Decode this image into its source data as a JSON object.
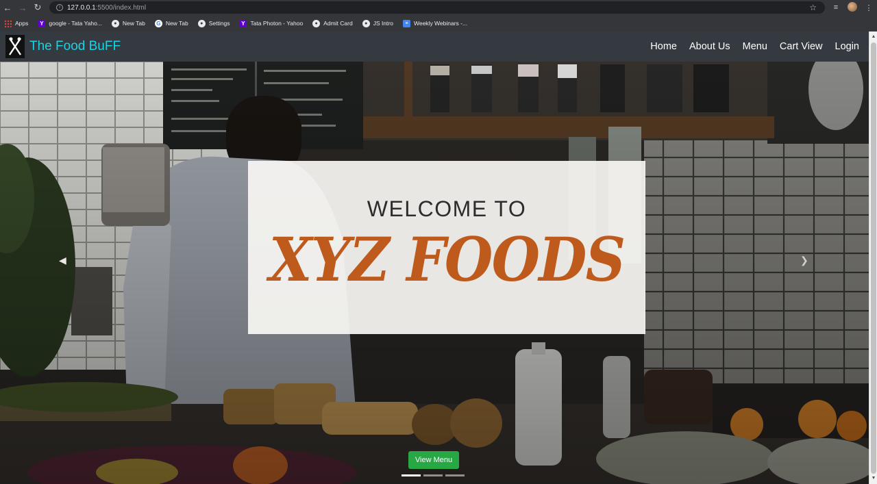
{
  "browser": {
    "url_host": "127.0.0.1",
    "url_rest": ":5500/index.html",
    "bookmarks": [
      {
        "label": "Apps",
        "icon": "apps-grid-icon"
      },
      {
        "label": "google - Tata Yaho...",
        "icon": "yahoo-icon"
      },
      {
        "label": "New Tab",
        "icon": "globe-icon"
      },
      {
        "label": "New Tab",
        "icon": "google-icon"
      },
      {
        "label": "Settings",
        "icon": "globe-icon"
      },
      {
        "label": "Tata Photon - Yahoo",
        "icon": "yahoo-icon"
      },
      {
        "label": "Admit Card",
        "icon": "globe-icon"
      },
      {
        "label": "JS Intro",
        "icon": "globe-icon"
      },
      {
        "label": "Weekly Webinars -...",
        "icon": "docs-icon"
      }
    ]
  },
  "site": {
    "brand": "The Food BuFF",
    "nav": [
      "Home",
      "About Us",
      "Menu",
      "Cart View",
      "Login"
    ],
    "hero": {
      "welcome_line": "WELCOME TO",
      "title": "XYZ FOODS",
      "cta": "View Menu",
      "slides": 3,
      "active_slide": 1
    },
    "colors": {
      "navbar": "#343a40",
      "brand": "#17d4e6",
      "title": "#bf5a1d",
      "cta": "#28a745"
    }
  }
}
